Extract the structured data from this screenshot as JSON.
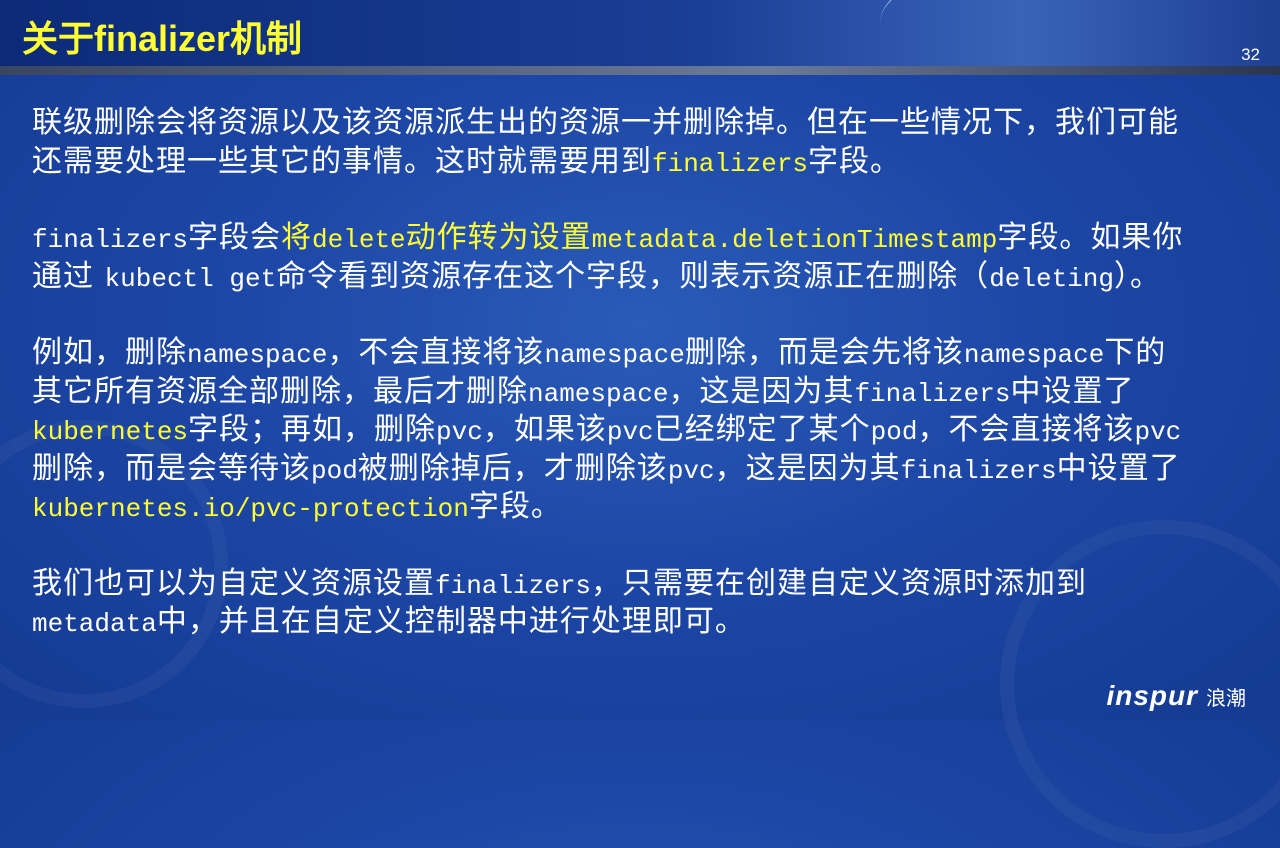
{
  "slide": {
    "title": "关于finalizer机制",
    "page_number": "32"
  },
  "colors": {
    "highlight": "#ffff33",
    "background": "#1d47a6"
  },
  "logo": {
    "brand": "inspur",
    "brand_cn": "浪潮"
  },
  "paragraphs": [
    {
      "lines": [
        [
          {
            "t": "联级删除会将资源以及该资源派生出的资源一并删除掉。但在一些情况下，我们可能"
          }
        ],
        [
          {
            "t": "还需要处理一些其它的事情。这时就需要用到"
          },
          {
            "t": "finalizers",
            "m": 1,
            "y": 1
          },
          {
            "t": "字段。"
          }
        ]
      ]
    },
    {
      "lines": [
        [
          {
            "t": "finalizers",
            "m": 1
          },
          {
            "t": "字段会"
          },
          {
            "t": "将",
            "y": 1
          },
          {
            "t": "delete",
            "m": 1,
            "y": 1
          },
          {
            "t": "动作转为设置",
            "y": 1
          },
          {
            "t": "metadata.deletionTimestamp",
            "m": 1,
            "y": 1
          },
          {
            "t": "字段。如果你"
          }
        ],
        [
          {
            "t": "通过 "
          },
          {
            "t": "kubectl get",
            "m": 1
          },
          {
            "t": "命令看到资源存在这个字段，则表示资源正在删除（"
          },
          {
            "t": "deleting",
            "m": 1
          },
          {
            "t": "）。"
          }
        ]
      ]
    },
    {
      "lines": [
        [
          {
            "t": "例如，删除"
          },
          {
            "t": "namespace",
            "m": 1
          },
          {
            "t": "，不会直接将该"
          },
          {
            "t": "namespace",
            "m": 1
          },
          {
            "t": "删除，而是会先将该"
          },
          {
            "t": "namespace",
            "m": 1
          },
          {
            "t": "下的"
          }
        ],
        [
          {
            "t": "其它所有资源全部删除，最后才删除"
          },
          {
            "t": "namespace",
            "m": 1
          },
          {
            "t": "，这是因为其"
          },
          {
            "t": "finalizers",
            "m": 1
          },
          {
            "t": "中设置了"
          }
        ],
        [
          {
            "t": "kubernetes",
            "m": 1,
            "y": 1
          },
          {
            "t": "字段；再如，删除"
          },
          {
            "t": "pvc",
            "m": 1
          },
          {
            "t": "，如果该"
          },
          {
            "t": "pvc",
            "m": 1
          },
          {
            "t": "已经绑定了某个"
          },
          {
            "t": "pod",
            "m": 1
          },
          {
            "t": "，不会直接将该"
          },
          {
            "t": "pvc",
            "m": 1
          }
        ],
        [
          {
            "t": "删除，而是会等待该"
          },
          {
            "t": "pod",
            "m": 1
          },
          {
            "t": "被删除掉后，才删除该"
          },
          {
            "t": "pvc",
            "m": 1
          },
          {
            "t": "，这是因为其"
          },
          {
            "t": "finalizers",
            "m": 1
          },
          {
            "t": "中设置了"
          }
        ],
        [
          {
            "t": "kubernetes.io/pvc-protection",
            "m": 1,
            "y": 1
          },
          {
            "t": "字段。"
          }
        ]
      ]
    },
    {
      "lines": [
        [
          {
            "t": "我们也可以为自定义资源设置"
          },
          {
            "t": "finalizers",
            "m": 1
          },
          {
            "t": "，只需要在创建自定义资源时添加到"
          }
        ],
        [
          {
            "t": "metadata",
            "m": 1
          },
          {
            "t": "中，并且在自定义控制器中进行处理即可。"
          }
        ]
      ]
    }
  ]
}
